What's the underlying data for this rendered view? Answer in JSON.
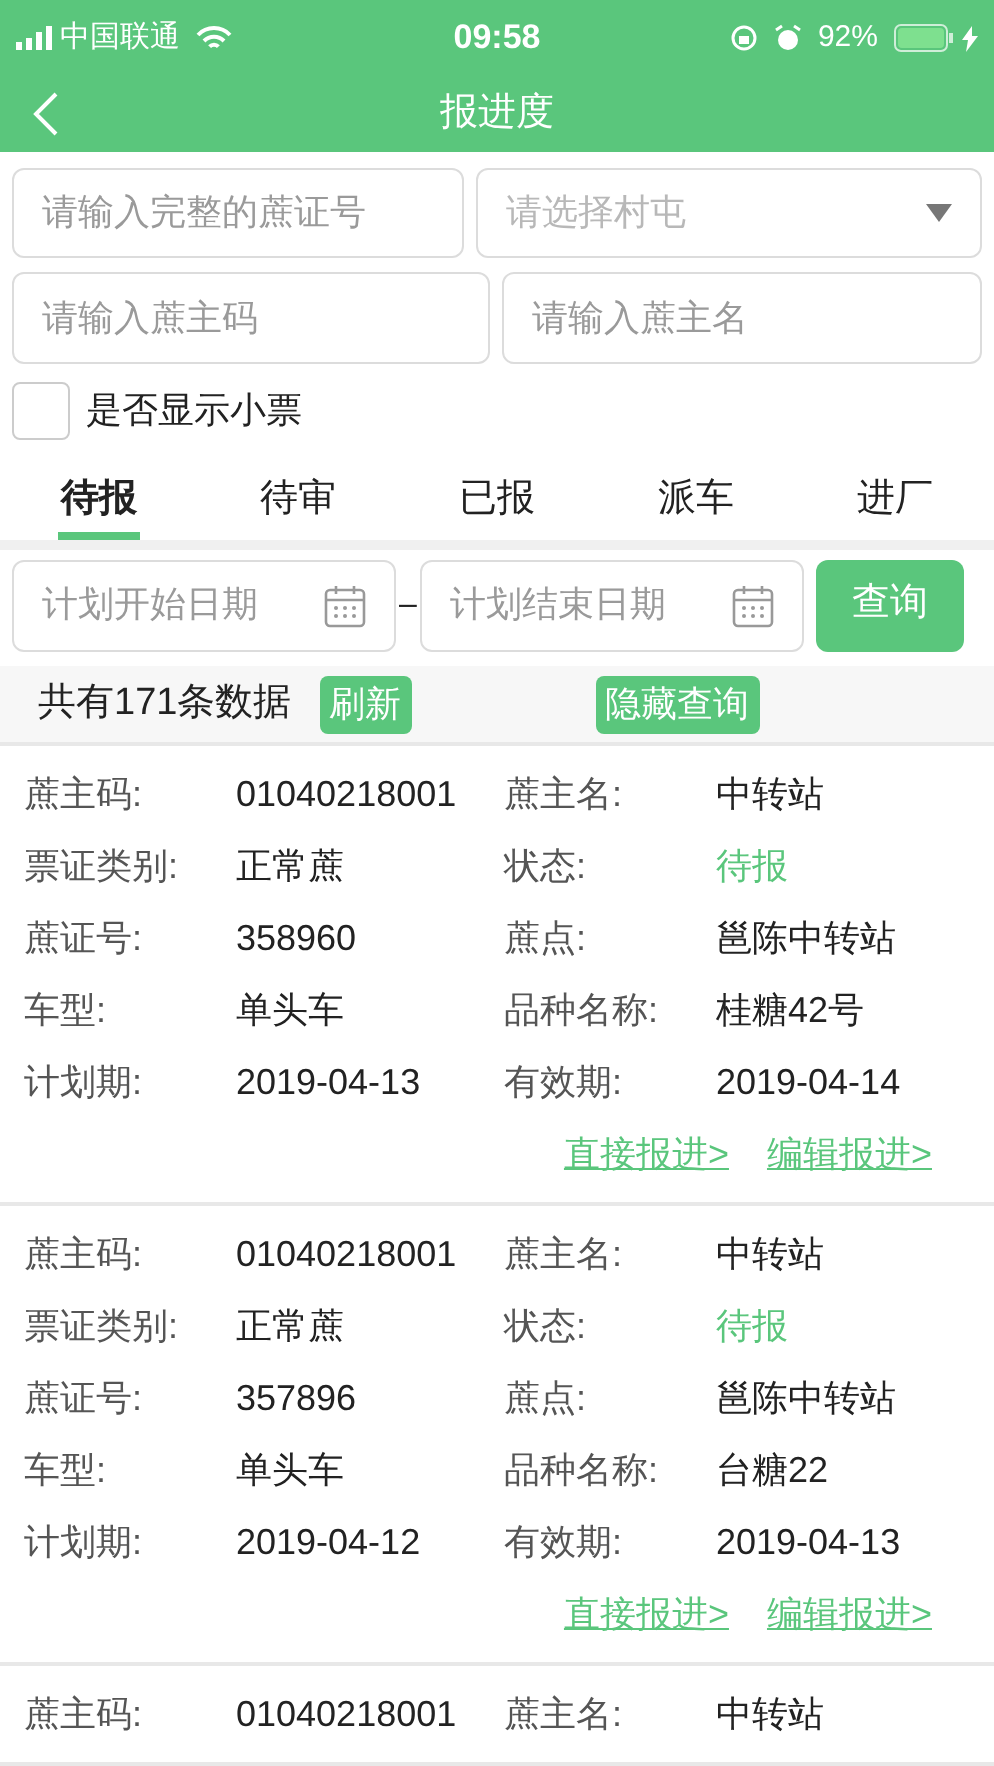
{
  "status_bar": {
    "carrier": "中国联通",
    "time": "09:58",
    "battery": "92%"
  },
  "nav": {
    "title": "报进度"
  },
  "filters": {
    "cert_no": {
      "placeholder": "请输入完整的蔗证号"
    },
    "village": {
      "placeholder": "请选择村屯"
    },
    "owner_code": {
      "placeholder": "请输入蔗主码"
    },
    "owner_name": {
      "placeholder": "请输入蔗主名"
    },
    "show_ticket": {
      "label": "是否显示小票",
      "checked": false
    }
  },
  "tabs": [
    {
      "label": "待报",
      "selected": true
    },
    {
      "label": "待审",
      "selected": false
    },
    {
      "label": "已报",
      "selected": false
    },
    {
      "label": "派车",
      "selected": false
    },
    {
      "label": "进厂",
      "selected": false
    }
  ],
  "date_range": {
    "start": {
      "placeholder": "计划开始日期"
    },
    "separator": "–",
    "end": {
      "placeholder": "计划结束日期"
    },
    "query_button": "查询"
  },
  "summary": {
    "count_text": "共有171条数据",
    "refresh_button": "刷新",
    "hide_button": "隐藏查询"
  },
  "records": [
    {
      "fields": [
        {
          "label": "蔗主码:",
          "value": "01040218001",
          "kind": "plain"
        },
        {
          "label": "蔗主名:",
          "value": "中转站",
          "kind": "plain"
        },
        {
          "label": "票证类别:",
          "value": "正常蔗",
          "kind": "plain"
        },
        {
          "label": "状态:",
          "value": "待报",
          "kind": "status"
        },
        {
          "label": "蔗证号:",
          "value": "358960",
          "kind": "plain"
        },
        {
          "label": "蔗点:",
          "value": "邕陈中转站",
          "kind": "plain"
        },
        {
          "label": "车型:",
          "value": "单头车",
          "kind": "plain"
        },
        {
          "label": "品种名称:",
          "value": "桂糖42号",
          "kind": "plain"
        },
        {
          "label": "计划期:",
          "value": "2019-04-13",
          "kind": "plain"
        },
        {
          "label": "有效期:",
          "value": "2019-04-14",
          "kind": "plain"
        }
      ],
      "links": [
        "直接报进>",
        "编辑报进>"
      ]
    },
    {
      "fields": [
        {
          "label": "蔗主码:",
          "value": "01040218001",
          "kind": "plain"
        },
        {
          "label": "蔗主名:",
          "value": "中转站",
          "kind": "plain"
        },
        {
          "label": "票证类别:",
          "value": "正常蔗",
          "kind": "plain"
        },
        {
          "label": "状态:",
          "value": "待报",
          "kind": "status"
        },
        {
          "label": "蔗证号:",
          "value": "357896",
          "kind": "plain"
        },
        {
          "label": "蔗点:",
          "value": "邕陈中转站",
          "kind": "plain"
        },
        {
          "label": "车型:",
          "value": "单头车",
          "kind": "plain"
        },
        {
          "label": "品种名称:",
          "value": "台糖22",
          "kind": "plain"
        },
        {
          "label": "计划期:",
          "value": "2019-04-12",
          "kind": "plain"
        },
        {
          "label": "有效期:",
          "value": "2019-04-13",
          "kind": "plain"
        }
      ],
      "links": [
        "直接报进>",
        "编辑报进>"
      ]
    },
    {
      "fields": [
        {
          "label": "蔗主码:",
          "value": "01040218001",
          "kind": "plain"
        },
        {
          "label": "蔗主名:",
          "value": "中转站",
          "kind": "plain"
        }
      ]
    }
  ]
}
